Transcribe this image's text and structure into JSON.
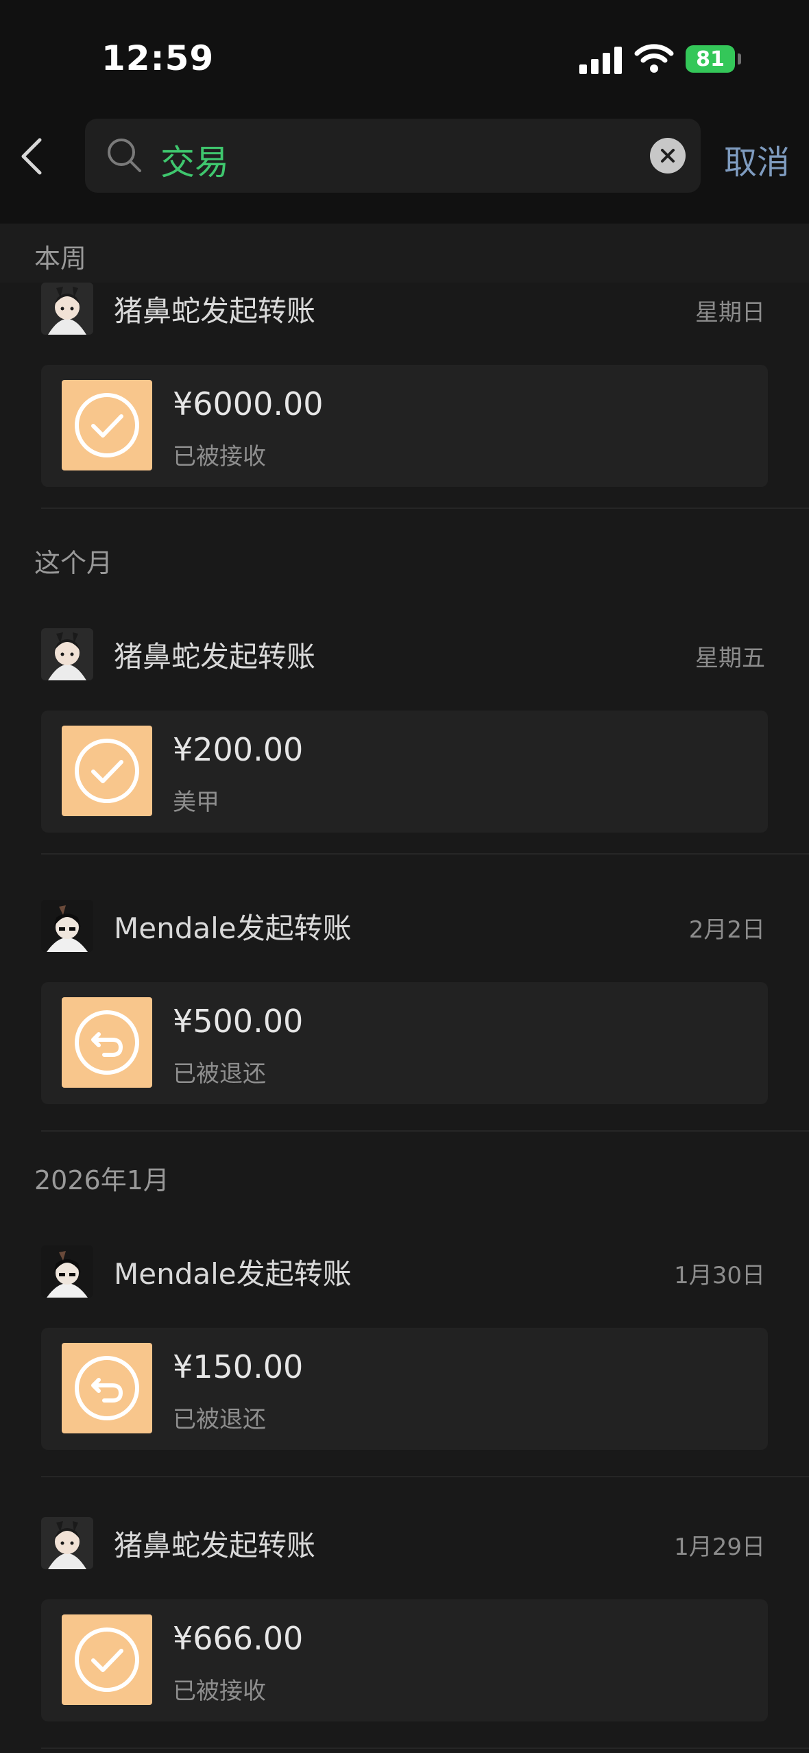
{
  "status_bar": {
    "time": "12:59",
    "battery": "81"
  },
  "search": {
    "query": "交易",
    "cancel_label": "取消"
  },
  "sections": [
    {
      "label": "本周"
    },
    {
      "label": "这个月"
    },
    {
      "label": "2026年1月"
    }
  ],
  "records": [
    {
      "sender": "猪鼻蛇发起转账",
      "date": "星期日",
      "amount": "¥6000.00",
      "status": "已被接收",
      "icon": "check-icon"
    },
    {
      "sender": "猪鼻蛇发起转账",
      "date": "星期五",
      "amount": "¥200.00",
      "status": "美甲",
      "icon": "check-icon"
    },
    {
      "sender": "Mendale发起转账",
      "date": "2月2日",
      "amount": "¥500.00",
      "status": "已被退还",
      "icon": "return-icon"
    },
    {
      "sender": "Mendale发起转账",
      "date": "1月30日",
      "amount": "¥150.00",
      "status": "已被退还",
      "icon": "return-icon"
    },
    {
      "sender": "猪鼻蛇发起转账",
      "date": "1月29日",
      "amount": "¥666.00",
      "status": "已被接收",
      "icon": "check-icon"
    }
  ],
  "colors": {
    "accent_green": "#3fc76e",
    "cancel_blue": "#7f9cc0",
    "card_icon": "#f8c68c",
    "background": "#191919"
  }
}
